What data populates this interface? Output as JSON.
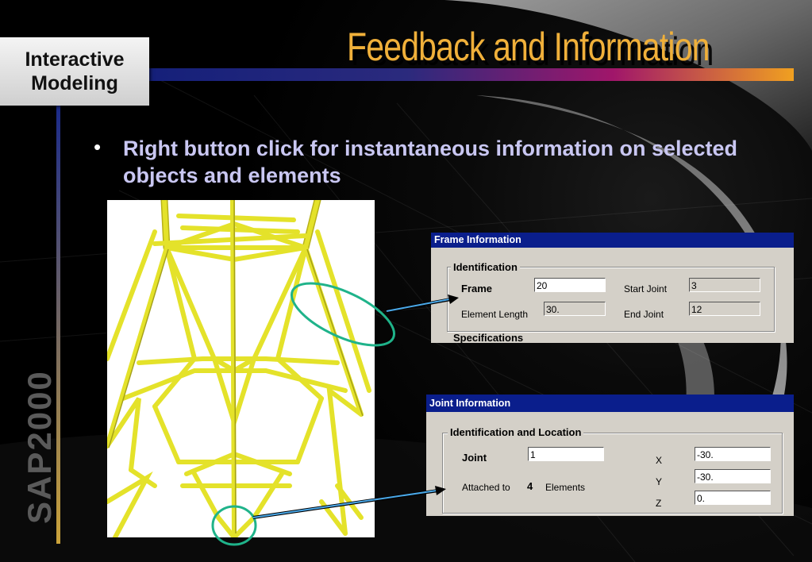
{
  "slide": {
    "title": "Feedback and Information",
    "badge": {
      "line1": "Interactive",
      "line2": "Modeling"
    },
    "side_brand": "SAP2000",
    "bullet_marker": "•",
    "bullet": "Right button click for instantaneous information on selected objects and elements"
  },
  "colors": {
    "title": "#f0b03a",
    "bullet": "#c9c7f2",
    "titlebar": "#0a1e8c",
    "dialog_bg": "#d4d0c8",
    "callout": "#1fb38a",
    "arrow": "#4aa8e8",
    "tower": "#e4e22a"
  },
  "frame_info": {
    "title": "Frame Information",
    "group_identification": "Identification",
    "frame_label": "Frame",
    "frame_value": "20",
    "start_joint_label": "Start Joint",
    "start_joint_value": "3",
    "element_length_label": "Element Length",
    "element_length_value": "30.",
    "end_joint_label": "End Joint",
    "end_joint_value": "12",
    "group_specifications": "Specifications"
  },
  "joint_info": {
    "title": "Joint Information",
    "group_identification": "Identification and Location",
    "joint_label": "Joint",
    "joint_value": "1",
    "attached_to_label": "Attached to",
    "attached_count": "4",
    "elements_label": "Elements",
    "x_label": "X",
    "x_value": "-30.",
    "y_label": "Y",
    "y_value": "-30.",
    "z_label": "Z",
    "z_value": "0."
  }
}
